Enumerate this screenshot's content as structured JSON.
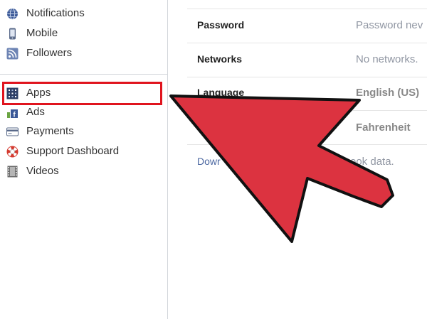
{
  "sidebar": {
    "items": [
      {
        "label": "Notifications",
        "icon": "globe-icon"
      },
      {
        "label": "Mobile",
        "icon": "mobile-phone-icon"
      },
      {
        "label": "Followers",
        "icon": "rss-feed-icon"
      },
      {
        "label": "Apps",
        "icon": "apps-grid-icon"
      },
      {
        "label": "Ads",
        "icon": "ads-icon"
      },
      {
        "label": "Payments",
        "icon": "credit-card-icon"
      },
      {
        "label": "Support Dashboard",
        "icon": "life-ring-icon"
      },
      {
        "label": "Videos",
        "icon": "film-icon"
      }
    ],
    "highlighted": "Apps"
  },
  "settings": {
    "rows": [
      {
        "label": "Password",
        "value": "Password nev"
      },
      {
        "label": "Networks",
        "value": "No networks."
      },
      {
        "label": "Language",
        "value": "English (US)"
      },
      {
        "label": "",
        "value": "Fahrenheit"
      }
    ],
    "download_link": "Dowr",
    "download_tail": "ook data."
  },
  "colors": {
    "highlight": "#e0141e",
    "arrow_fill": "#dc3340",
    "link": "#4b67a1"
  }
}
